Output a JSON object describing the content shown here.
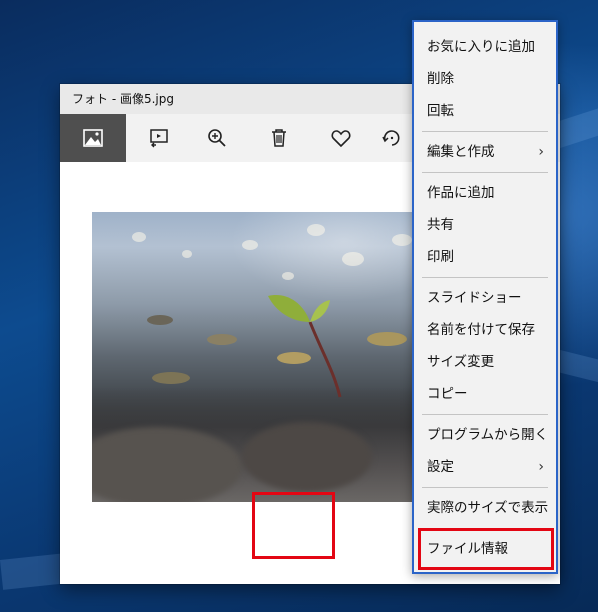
{
  "window": {
    "title": "フォト - 画像5.jpg"
  },
  "toolbar": {
    "buttons": [
      {
        "name": "image-icon",
        "active": true
      },
      {
        "name": "slideshow-icon",
        "active": false
      },
      {
        "name": "zoom-icon",
        "active": false
      },
      {
        "name": "delete-icon",
        "active": false
      },
      {
        "name": "heart-icon",
        "active": false
      },
      {
        "name": "rotate-icon",
        "active": false
      }
    ]
  },
  "context_menu": {
    "items": [
      {
        "label": "お気に入りに追加"
      },
      {
        "label": "削除"
      },
      {
        "label": "回転"
      },
      {
        "label": "編集と作成",
        "submenu": true
      },
      {
        "label": "作品に追加"
      },
      {
        "label": "共有"
      },
      {
        "label": "印刷"
      },
      {
        "label": "スライドショー"
      },
      {
        "label": "名前を付けて保存"
      },
      {
        "label": "サイズ変更"
      },
      {
        "label": "コピー"
      },
      {
        "label": "プログラムから開く"
      },
      {
        "label": "設定",
        "submenu": true
      },
      {
        "label": "実際のサイズで表示"
      },
      {
        "label": "ファイル情報",
        "highlighted": true
      }
    ],
    "chevron": "›"
  },
  "colors": {
    "highlight": "#e30613",
    "menu_border": "#2b64c8",
    "active_button": "#4f4f4f"
  }
}
